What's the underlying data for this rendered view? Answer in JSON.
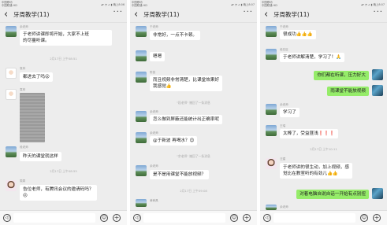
{
  "status": {
    "left": "中国移动\n中国联通 HD",
    "right_1": "▴▾ ◔ ⊿ ▮ 晚上8:06",
    "right_2": "▴▾ ◔ ⊿ ▮ 晚上8:07",
    "right_3": "▴▾ ◔ ⊿ ▮ 晚上8:07"
  },
  "chat": {
    "title": "牙周教学(11)",
    "back": "‹",
    "more": "···"
  },
  "panel1": {
    "messages": [
      {
        "sender": "余老师",
        "text": "于老师讲课即将开始，大家不上班",
        "text2": "的尽量听课。"
      },
      {
        "time": "2月17日 上午08:51"
      },
      {
        "sender": "袁林",
        "text": "都进去了吗😮"
      },
      {
        "sender": "袁林"
      },
      {
        "sender": "段老师",
        "text": "昨天的课堂就这样"
      },
      {
        "time": "2月17日 上午08:55"
      },
      {
        "sender": "周周",
        "text": "告位老师，有腾讯会议的邀请码吗？",
        "text2": "😐"
      }
    ]
  },
  "panel2": {
    "messages": [
      {
        "sender": "于老师",
        "text": "非常好，一点不卡顿。"
      },
      {
        "text": "嗯嗯"
      },
      {
        "sender": "陈俊",
        "text": "而且视频非常清楚，比课堂效果好",
        "text2": "我感觉👍"
      },
      {
        "system": "\"段老师\" 撤回了一条消息"
      },
      {
        "sender": "余老师",
        "text": "怎么做到屏蔽还能统计出正确率呢"
      },
      {
        "sender": "余老师",
        "text": "@于新波  再喝水？😊"
      },
      {
        "system": "\"余老师\" 撤回了一条消息"
      },
      {
        "sender": "余老师",
        "text": "是不是用课堂不能放视频？"
      },
      {
        "time": "2月17日 上午09:08"
      },
      {
        "sender": "黄韩具"
      }
    ]
  },
  "panel3": {
    "messages": [
      {
        "sender": "于老师",
        "text": "很成功👍👍👍"
      },
      {
        "sender": "段在臣",
        "text": "于老师讲解清楚，学习了！🙏"
      },
      {
        "text": "你们都在听课，压力好大",
        "mine": true
      },
      {
        "text": "雨课堂不能放视频",
        "mine": true
      },
      {
        "sender": "余老师",
        "text": "学习了"
      },
      {
        "sender": "王瑞",
        "text": "太棒了，受益匪浅❗❗❗"
      },
      {
        "time": "2月17日 上午10:11"
      },
      {
        "sender": "汪建",
        "text": "于老师讲的很生动，加上视频，感",
        "text2": "觉比在教室听的有劲儿👍👍"
      },
      {
        "text": "对着电脑自说自话一开始有点别扭",
        "mine": true
      },
      {
        "sender": "余老师"
      }
    ]
  },
  "input": {
    "voice": "◁)",
    "emoji": "☺",
    "plus": "+"
  }
}
